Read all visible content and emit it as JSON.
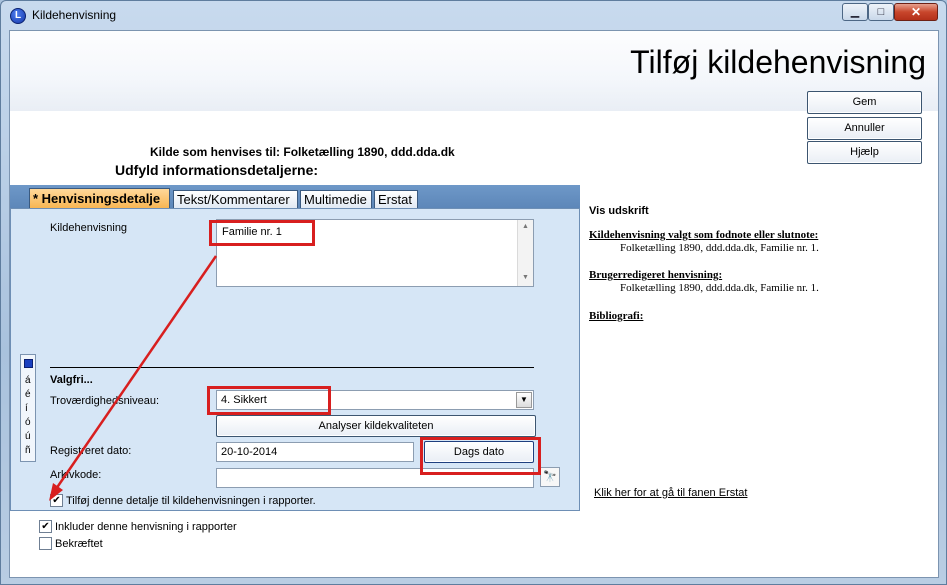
{
  "window": {
    "title": "Kildehenvisning",
    "app_icon_letter": "L",
    "minimize_glyph": "▁",
    "maximize_glyph": "□",
    "close_glyph": "✕"
  },
  "header": {
    "page_title": "Tilføj kildehenvisning"
  },
  "actions": {
    "save": "Gem",
    "cancel": "Annuller",
    "help": "Hjælp"
  },
  "source_ref": "Kilde som henvises til: Folketælling 1890, ddd.dda.dk",
  "fill_heading": "Udfyld informationsdetaljerne:",
  "tabs": [
    {
      "label": "* Henvisningsdetalje",
      "active": true
    },
    {
      "label": "Tekst/Kommentarer",
      "active": false
    },
    {
      "label": "Multimedie",
      "active": false
    },
    {
      "label": "Erstat",
      "active": false
    }
  ],
  "form": {
    "ref_label": "Kildehenvisning",
    "ref_value": "Familie nr. 1",
    "optional_heading": "Valgfri...",
    "trov_label": "Troværdighedsniveau:",
    "trov_value": "4.  Sikkert",
    "analyze_button": "Analyser kildekvaliteten",
    "date_label": "Registreret dato:",
    "date_value": "20-10-2014",
    "today_button": "Dags dato",
    "arkiv_label": "Arkivkode:",
    "arkiv_value": "",
    "add_detail_checkbox": {
      "label": "Tilføj denne detalje til kildehenvisningen i rapporter.",
      "checked": true
    },
    "include_checkbox": {
      "label": "Inkluder denne henvisning i rapporter",
      "checked": true
    },
    "confirmed_checkbox": {
      "label": "Bekræftet",
      "checked": false
    }
  },
  "side_strip": {
    "chars": [
      "á",
      "é",
      "í",
      "ó",
      "ú",
      "ñ"
    ]
  },
  "preview": {
    "heading": "Vis udskrift",
    "footnote_heading": "Kildehenvisning valgt som fodnote eller slutnote:",
    "footnote_text": "Folketælling 1890, ddd.dda.dk, Familie nr. 1.",
    "user_heading": "Brugerredigeret henvisning:",
    "user_text": "Folketælling 1890, ddd.dda.dk, Familie nr. 1.",
    "biblio_heading": "Bibliografi:",
    "erstat_link": "Klik her for at gå til fanen Erstat"
  },
  "colors": {
    "annotation_red": "#d81f1f",
    "panel_bg": "#d6e6f6",
    "active_tab": "#f7b44f",
    "tab_strip": "#5d87b9"
  }
}
